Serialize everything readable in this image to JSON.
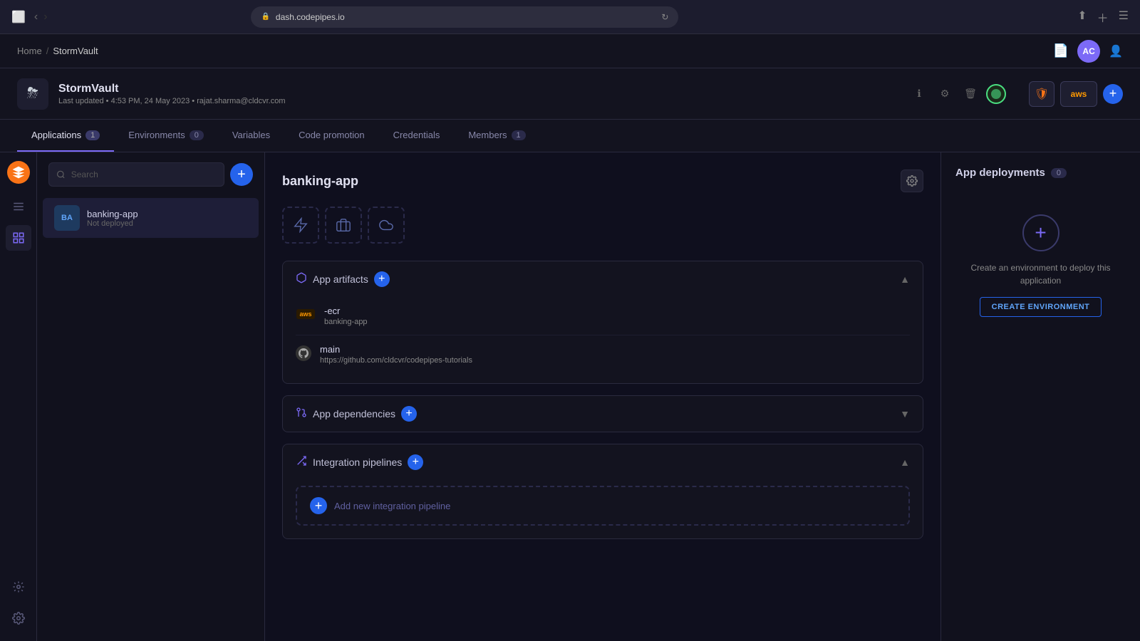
{
  "browser": {
    "url": "dash.codepipes.io",
    "back_disabled": false,
    "forward_disabled": true
  },
  "breadcrumb": {
    "home": "Home",
    "separator": "/",
    "current": "StormVault"
  },
  "header_icons": {
    "doc_icon": "☰",
    "user_initials": "AC"
  },
  "project": {
    "name": "StormVault",
    "icon": "⛈",
    "last_updated": "Last updated • 4:53 PM, 24 May 2023 •",
    "user_email": "rajat.sharma@cldcvr.com",
    "aws_label": "aws"
  },
  "tabs": [
    {
      "id": "applications",
      "label": "Applications",
      "badge": "1",
      "active": true
    },
    {
      "id": "environments",
      "label": "Environments",
      "badge": "0",
      "active": false
    },
    {
      "id": "variables",
      "label": "Variables",
      "badge": null,
      "active": false
    },
    {
      "id": "code_promotion",
      "label": "Code promotion",
      "badge": null,
      "active": false
    },
    {
      "id": "credentials",
      "label": "Credentials",
      "badge": null,
      "active": false
    },
    {
      "id": "members",
      "label": "Members",
      "badge": "1",
      "active": false
    }
  ],
  "search": {
    "placeholder": "Search"
  },
  "apps": [
    {
      "id": "banking-app",
      "initials": "BA",
      "name": "banking-app",
      "status": "Not deployed",
      "active": true
    }
  ],
  "app_detail": {
    "name": "banking-app",
    "sections": {
      "artifacts": {
        "title": "App artifacts",
        "items": [
          {
            "type": "ecr",
            "name": "-ecr",
            "sub": "banking-app"
          },
          {
            "type": "github",
            "name": "main",
            "sub": "https://github.com/cldcvr/codepipes-tutorials"
          }
        ]
      },
      "dependencies": {
        "title": "App dependencies"
      },
      "integration_pipelines": {
        "title": "Integration pipelines",
        "add_label": "Add new integration pipeline"
      }
    }
  },
  "deployments": {
    "title": "App deployments",
    "count": "0",
    "create_text": "Create an environment to deploy this application",
    "create_btn": "CREATE ENVIRONMENT"
  },
  "sidebar_nav": {
    "icons": [
      "≡",
      "◈",
      "◎",
      "⚯",
      "⚙"
    ]
  }
}
